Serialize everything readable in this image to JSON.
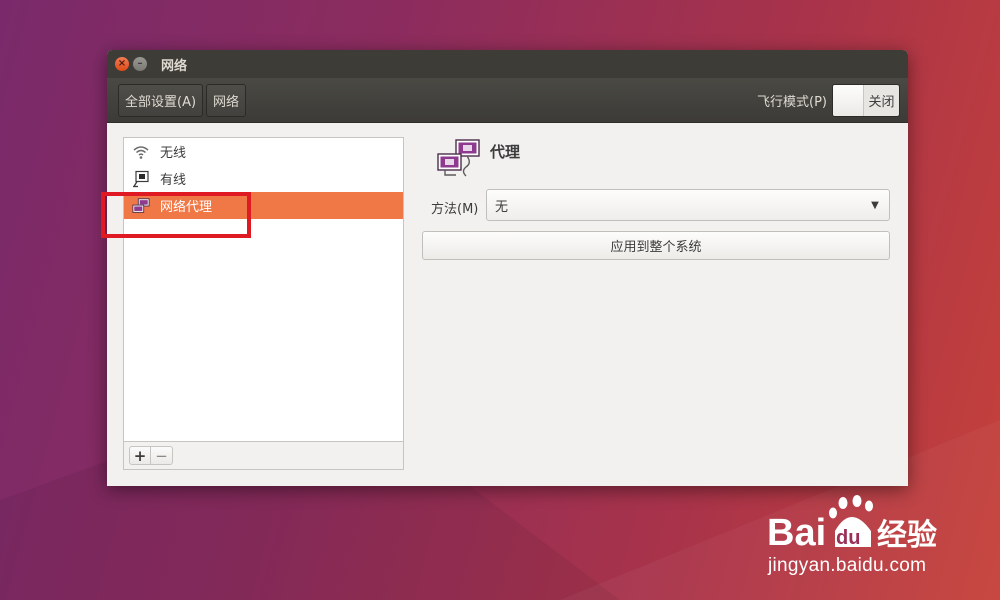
{
  "window": {
    "title": "网络",
    "close_glyph": "×",
    "minimize_glyph": "–"
  },
  "header": {
    "all_settings_label": "全部设置(A)",
    "breadcrumb_label": "网络",
    "airplane_label": "飞行模式(P)",
    "airplane_switch_text": "关闭",
    "airplane_on": false
  },
  "sidebar": {
    "items": [
      {
        "label": "无线",
        "icon": "wifi-icon",
        "selected": false
      },
      {
        "label": "有线",
        "icon": "wired-network-icon",
        "selected": false
      },
      {
        "label": "网络代理",
        "icon": "network-proxy-icon",
        "selected": true
      }
    ],
    "add_label": "+",
    "remove_label": "−"
  },
  "panel": {
    "title": "代理",
    "method_label": "方法(M)",
    "method_value": "无",
    "apply_label": "应用到整个系统"
  },
  "watermark": {
    "site": "jingyan.baidu.com",
    "logo_text": "Bai du 经验"
  },
  "colors": {
    "selection": "#f07746",
    "highlight_box": "#e01a22",
    "titlebar": "#3d3c37"
  }
}
